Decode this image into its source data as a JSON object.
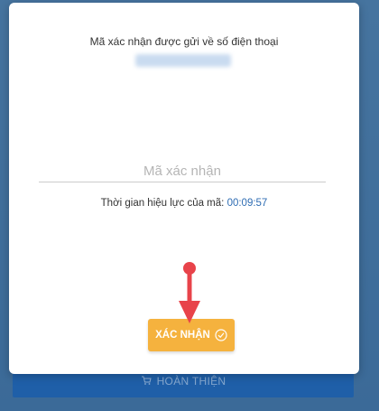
{
  "background": {
    "complete_button_label": "HOÀN THIỆN",
    "complete_icon": "cart-icon"
  },
  "modal": {
    "message": "Mã xác nhận được gửi về số điện thoại",
    "phone_number": "0123456789",
    "code_input": {
      "placeholder": "Mã xác nhận",
      "value": ""
    },
    "validity_label": "Thời gian hiệu lực của mã:",
    "timer": "00:09:57",
    "confirm_button": {
      "label": "XÁC NHẬN",
      "icon": "check-circle-icon"
    }
  },
  "annotation": {
    "icon": "red-arrow-icon",
    "color": "#e8434a"
  },
  "colors": {
    "accent": "#f5b23e",
    "timer": "#2f6db3",
    "background": "#3f6fa0",
    "complete_bar": "#1f5fa8"
  }
}
